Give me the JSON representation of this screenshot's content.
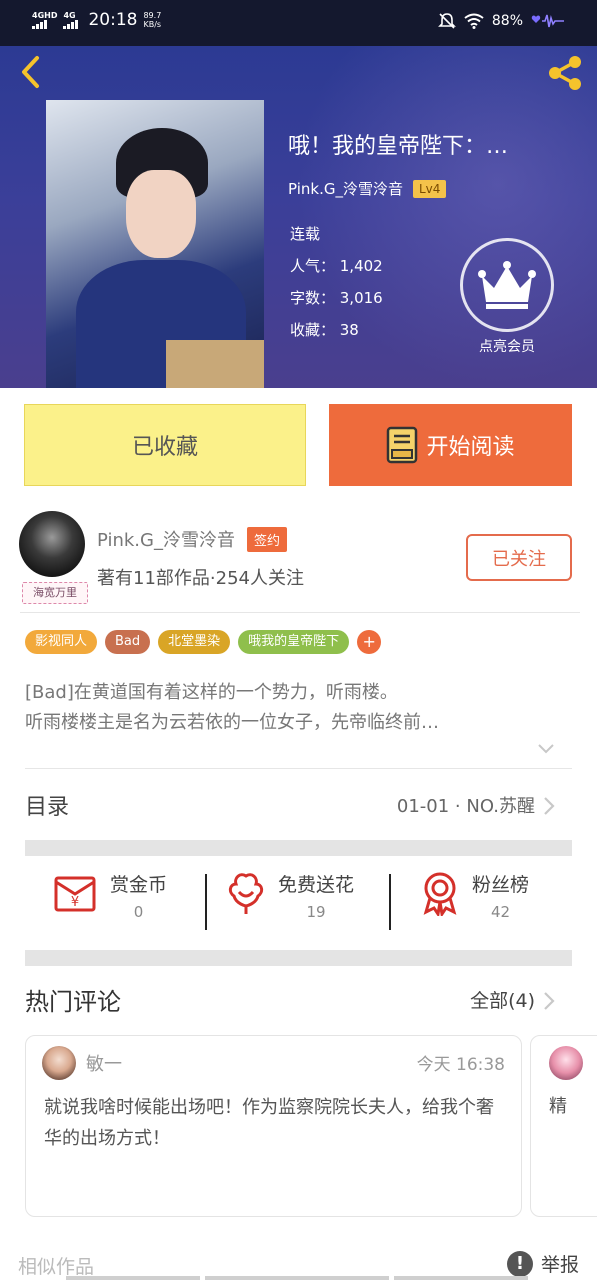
{
  "status_bar": {
    "network1": "4GHD",
    "network2": "4G",
    "time": "20:18",
    "speed_value": "89.7",
    "speed_unit": "KB/s",
    "battery": "88%"
  },
  "book": {
    "title": "哦！我的皇帝陛下：…",
    "author": "Pink.G_泠雪泠音",
    "level": "Lv4",
    "status": "连载",
    "popularity": "人气： 1,402",
    "word_count": "字数： 3,016",
    "favorites": "收藏： 38",
    "vip_label": "点亮会员"
  },
  "actions": {
    "collected_label": "已收藏",
    "read_label": "开始阅读"
  },
  "author_info": {
    "avatar_tag": "海宽万里",
    "name": "Pink.G_泠雪泠音",
    "signed_badge": "签约",
    "stats": "著有11部作品·254人关注",
    "follow_label": "已关注"
  },
  "tags": [
    {
      "label": "影视同人",
      "color": "#f2a93b"
    },
    {
      "label": "Bad",
      "color": "#c8704f"
    },
    {
      "label": "北堂墨染",
      "color": "#d9a526"
    },
    {
      "label": "哦我的皇帝陛下",
      "color": "#8fbf4c"
    },
    {
      "label": "+",
      "color": "#ee6b3c"
    }
  ],
  "description": {
    "line1": "[Bad]在黄道国有着这样的一个势力，听雨楼。",
    "line2": "听雨楼楼主是名为云若依的一位女子，先帝临终前…"
  },
  "catalog": {
    "label": "目录",
    "latest": "01-01 · NO.苏醒"
  },
  "rewards": [
    {
      "label": "赏金币",
      "count": "0",
      "icon": "red-envelope-icon"
    },
    {
      "label": "免费送花",
      "count": "19",
      "icon": "flower-icon"
    },
    {
      "label": "粉丝榜",
      "count": "42",
      "icon": "medal-icon"
    }
  ],
  "comments": {
    "title": "热门评论",
    "all_label": "全部(4)",
    "items": [
      {
        "user": "敏一",
        "time": "今天 16:38",
        "text": "就说我啥时候能出场吧！作为监察院院长夫人，给我个奢华的出场方式！"
      },
      {
        "text": "精"
      }
    ]
  },
  "footer": {
    "similar": "相似作品",
    "report": "举报",
    "report_icon_glyph": "!"
  },
  "colors": {
    "accent": "#ee6b3c",
    "collected_bg": "#fbf18a",
    "header_bg": "#2c3a93"
  }
}
